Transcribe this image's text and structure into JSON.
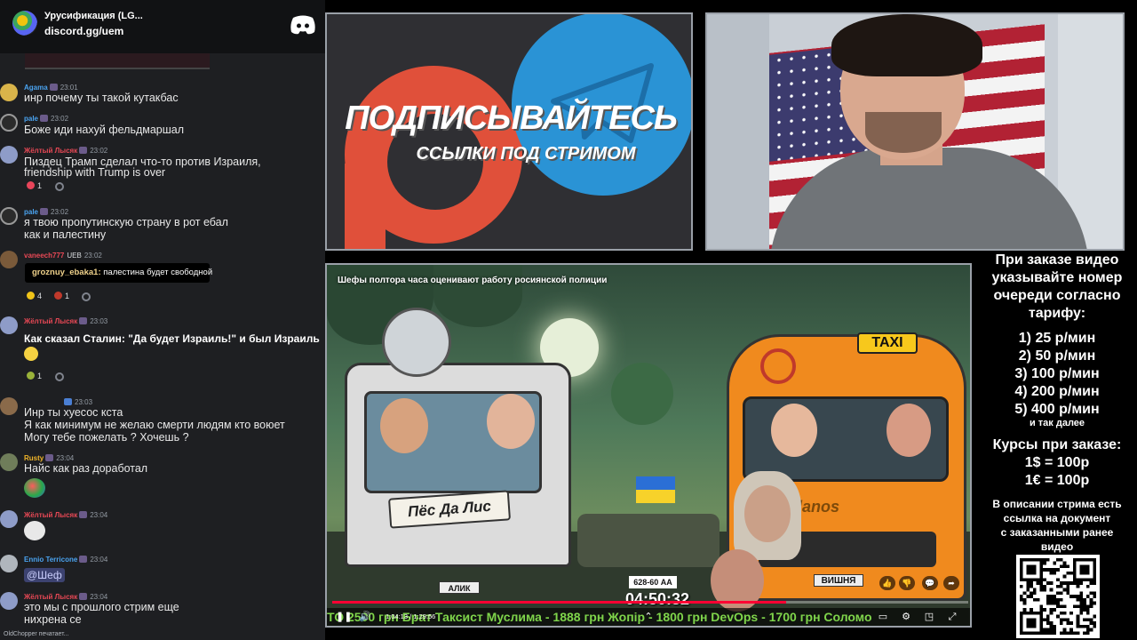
{
  "server": {
    "name": "Урусификация (LG...",
    "link": "discord.gg/uem"
  },
  "chat": {
    "messages": [
      {
        "nick": "Agama",
        "time": "23:01",
        "text": "инр почему ты такой кутакбас"
      },
      {
        "nick": "pale",
        "time": "23:02",
        "text": "Боже иди нахуй фельдмаршал"
      },
      {
        "nick": "Жёлтый Лысяк",
        "time": "23:02",
        "text1": "Пиздец Трамп сделал что-то против Израиля,",
        "text2": "friendship with Trump is over",
        "reaction": "1"
      },
      {
        "nick": "pale",
        "time": "23:02",
        "text1": "я твою пропутинскую страну в рот ебал",
        "text2": "как и палестину"
      },
      {
        "nick": "vaneech777",
        "badge": "UEB",
        "time": "23:02",
        "reply_nick": "groznuy_ebaka1:",
        "reply_text": "палестина будет свободной",
        "reaction1": "4",
        "reaction2": "1"
      },
      {
        "nick": "Жёлтый Лысяк",
        "time": "23:03",
        "text": "Как сказал Сталин: \"Да будет Израиль!\" и был Израиль",
        "reaction": "1"
      },
      {
        "time": "23:03",
        "text1": "Инр ты хуесос кста",
        "text2": "Я как минимум не желаю смерти людям кто воюет",
        "text3": "Могу тебе пожелать ? Хочешь ?"
      },
      {
        "nick": "Rusty",
        "time": "23:04",
        "text": "Найс как раз доработал"
      },
      {
        "nick": "Жёлтый Лысяк",
        "time": "23:04"
      },
      {
        "nick": "Ennio Terricone",
        "time": "23:04",
        "mention": "@Шеф"
      },
      {
        "nick": "Жёлтый Лысяк",
        "time": "23:04",
        "text1": "это мы с прошлого стрим еще",
        "text2": "нихрена се"
      }
    ],
    "typing": "OldChopper печатает..."
  },
  "banner": {
    "title": "ПОДПИСЫВАЙТЕСЬ",
    "subtitle": "ССЫЛКИ ПОД СТРИМОМ"
  },
  "video": {
    "title": "Шефы полтора часа оценивают работу росиянской полиции",
    "truck_sign": "Пёс Да Лис",
    "plate_left": "АЛИК",
    "plate_right": "ВИШНЯ",
    "van_brand": "lanos",
    "taxi": "TAXI",
    "phone": "628-60 АА",
    "clock": "04:50:32",
    "time": "1:04:13 / 1:29:56",
    "progress": 0.714,
    "ticker": "ТО 2500 грн   Брат Таксист Муслима - 1888 грн   Жопір - 1800 грн   DevOps - 1700 грн   Соломо"
  },
  "info": {
    "l1": "При заказе видео",
    "l2": "указывайте номер",
    "l3": "очереди согласно",
    "l4": "тарифу:",
    "t1": "1) 25 р/мин",
    "t2": "2) 50 р/мин",
    "t3": "3) 100 р/мин",
    "t4": "4) 200 р/мин",
    "t5": "5) 400 р/мин",
    "etc": "и так далее",
    "rates_title": "Курсы при заказе:",
    "usd": "1$ = 100р",
    "eur": "1€ = 100р",
    "d1": "В описании стрима есть",
    "d2": "ссылка на документ",
    "d3": "с заказанными ранее",
    "d4": "видео"
  },
  "colors": {
    "discord_bg": "#1e1f22",
    "ticker": "#7fd54b",
    "progress": "#ff0033"
  }
}
